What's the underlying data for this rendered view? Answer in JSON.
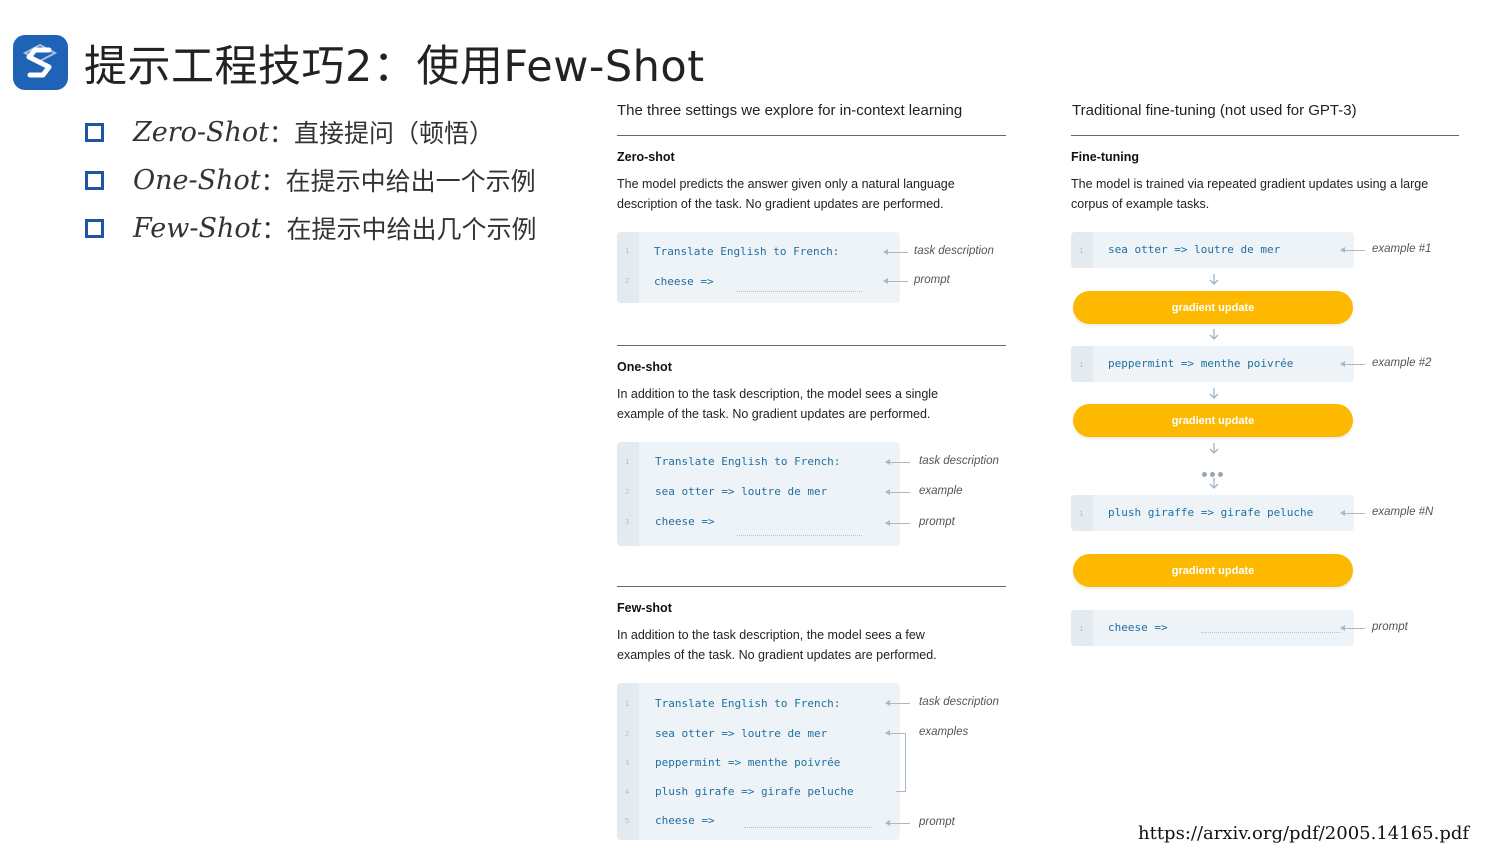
{
  "title": "提示工程技巧2：使用Few-Shot",
  "logo": {
    "icon": "s-logo-icon",
    "color": "#1f63b6"
  },
  "bullets": [
    {
      "term": "Zero-Shot",
      "desc": "：直接提问（顿悟）"
    },
    {
      "term": "One-Shot",
      "desc": "：在提示中给出一个示例"
    },
    {
      "term": "Few-Shot",
      "desc": "：在提示中给出几个示例"
    }
  ],
  "left_panel": {
    "heading": "The three settings we explore for in-context learning",
    "zero": {
      "title": "Zero-shot",
      "desc": "The model predicts the answer given only a natural language description of the task. No gradient updates are performed.",
      "lines": [
        "Translate English to French:",
        "cheese =>"
      ],
      "annotations": [
        "task description",
        "prompt"
      ]
    },
    "one": {
      "title": "One-shot",
      "desc": "In addition to the task description, the model sees a single example of the task. No gradient updates are performed.",
      "lines": [
        "Translate English to French:",
        "sea otter => loutre de mer",
        "cheese =>"
      ],
      "annotations": [
        "task description",
        "example",
        "prompt"
      ]
    },
    "few": {
      "title": "Few-shot",
      "desc": "In addition to the task description, the model sees a few examples of the task. No gradient updates are performed.",
      "lines": [
        "Translate English to French:",
        "sea otter => loutre de mer",
        "peppermint => menthe poivrée",
        "plush girafe => girafe peluche",
        "cheese =>"
      ],
      "annotations": [
        "task description",
        "examples",
        "prompt"
      ]
    }
  },
  "right_panel": {
    "heading": "Traditional fine-tuning (not used for GPT-3)",
    "title": "Fine-tuning",
    "desc": "The model is trained via repeated gradient updates using a large corpus of example tasks.",
    "examples": [
      {
        "code": "sea otter => loutre de mer",
        "label": "example #1"
      },
      {
        "code": "peppermint => menthe poivrée",
        "label": "example #2"
      },
      {
        "code": "plush giraffe => girafe peluche",
        "label": "example #N"
      }
    ],
    "gradient_label": "gradient update",
    "prompt": {
      "code": "cheese =>",
      "label": "prompt"
    },
    "accent": "#fdb900"
  },
  "line_numbers": [
    "1",
    "2",
    "3",
    "4",
    "5"
  ],
  "source_url": "https://arxiv.org/pdf/2005.14165.pdf"
}
